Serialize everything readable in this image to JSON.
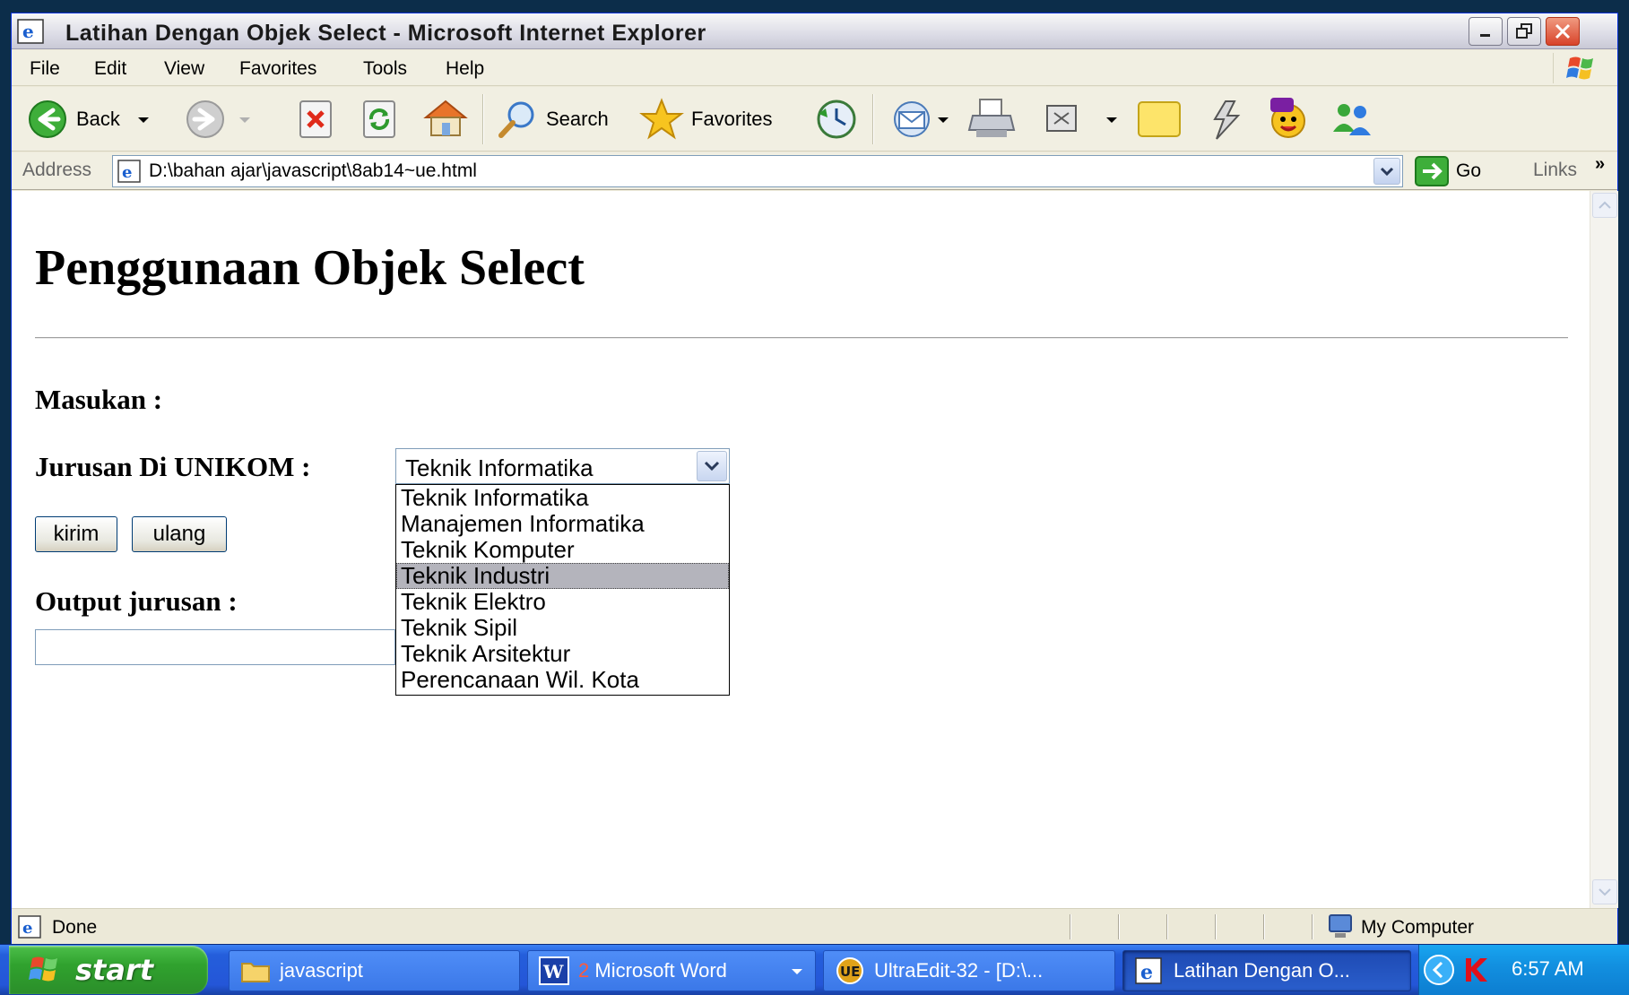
{
  "window": {
    "title": "Latihan Dengan Objek Select - Microsoft Internet Explorer"
  },
  "menu": [
    "File",
    "Edit",
    "View",
    "Favorites",
    "Tools",
    "Help"
  ],
  "toolbar": {
    "back_label": "Back",
    "search_label": "Search",
    "favorites_label": "Favorites"
  },
  "address": {
    "label": "Address",
    "value": "D:\\bahan ajar\\javascript\\8ab14~ue.html",
    "go_label": "Go",
    "links_label": "Links"
  },
  "page": {
    "heading": "Penggunaan Objek Select",
    "input_label": "Masukan :",
    "select_label": "Jurusan Di UNIKOM :",
    "select_value": "Teknik Informatika",
    "options": [
      "Teknik Informatika",
      "Manajemen Informatika",
      "Teknik Komputer",
      "Teknik Industri",
      "Teknik Elektro",
      "Teknik Sipil",
      "Teknik Arsitektur",
      "Perencanaan Wil. Kota"
    ],
    "highlighted_option": "Teknik Industri",
    "submit_label": "kirim",
    "reset_label": "ulang",
    "output_label": "Output jurusan :",
    "output_value": ""
  },
  "status": {
    "text": "Done",
    "zone": "My Computer"
  },
  "taskbar": {
    "start_label": "start",
    "tasks": [
      {
        "label": "javascript"
      },
      {
        "label": "Microsoft Word",
        "count": "2"
      },
      {
        "label": "UltraEdit-32 - [D:\\..."
      },
      {
        "label": "Latihan Dengan O..."
      }
    ],
    "clock": "6:57 AM"
  }
}
